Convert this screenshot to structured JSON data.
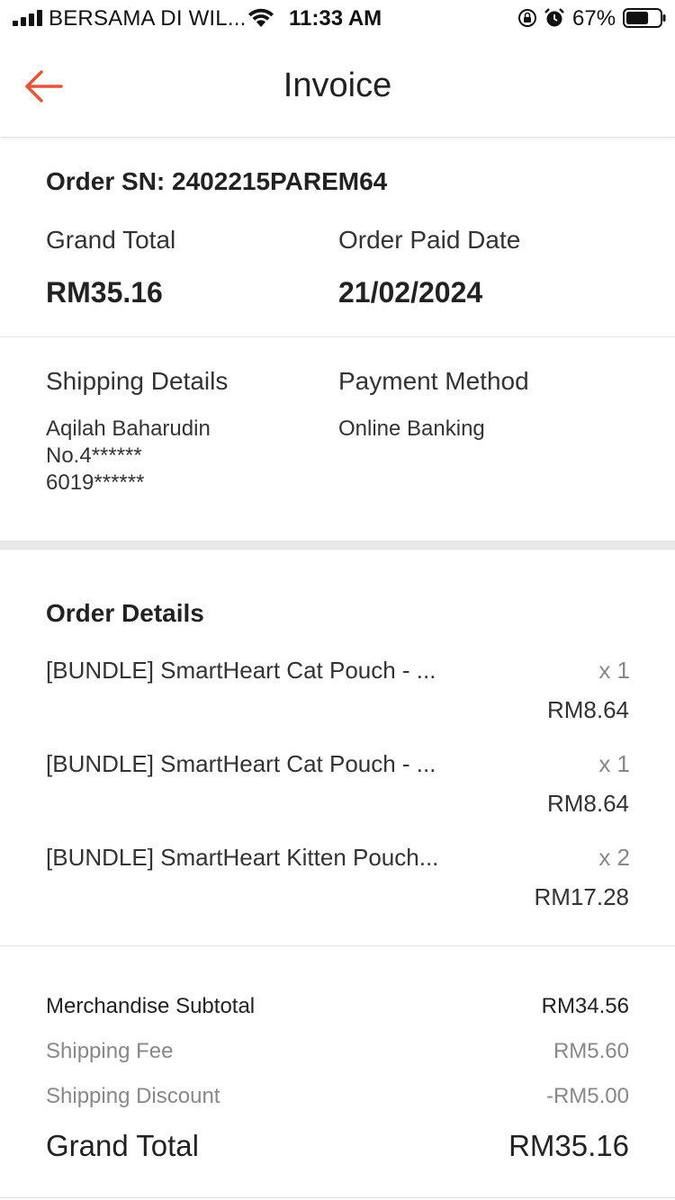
{
  "status_bar": {
    "carrier": "BERSAMA DI WIL...",
    "time": "11:33 AM",
    "battery_percent": "67%",
    "battery_level": 0.67,
    "icons": [
      "signal-icon",
      "wifi-icon",
      "orientation-lock-icon",
      "alarm-icon",
      "battery-icon"
    ]
  },
  "nav": {
    "title": "Invoice",
    "back_icon": "arrow-left-icon",
    "accent_color": "#e0573a"
  },
  "summary": {
    "order_sn": "Order SN: 2402215PAREM64",
    "grand_total_label": "Grand Total",
    "grand_total_value": "RM35.16",
    "paid_date_label": "Order Paid Date",
    "paid_date_value": "21/02/2024"
  },
  "shipping": {
    "label": "Shipping Details",
    "name": "Aqilah Baharudin",
    "address": "No.4******",
    "phone": "6019******"
  },
  "payment": {
    "label": "Payment Method",
    "method": "Online Banking"
  },
  "order_details": {
    "title": "Order Details",
    "items": [
      {
        "name": "[BUNDLE] SmartHeart Cat Pouch - ...",
        "qty": "x 1",
        "price": "RM8.64"
      },
      {
        "name": "[BUNDLE] SmartHeart Cat Pouch - ...",
        "qty": "x 1",
        "price": "RM8.64"
      },
      {
        "name": "[BUNDLE] SmartHeart Kitten Pouch...",
        "qty": "x 2",
        "price": "RM17.28"
      }
    ]
  },
  "totals": {
    "merch_label": "Merchandise Subtotal",
    "merch_value": "RM34.56",
    "ship_fee_label": "Shipping Fee",
    "ship_fee_value": "RM5.60",
    "ship_disc_label": "Shipping Discount",
    "ship_disc_value": "-RM5.00",
    "grand_label": "Grand Total",
    "grand_value": "RM35.16"
  }
}
